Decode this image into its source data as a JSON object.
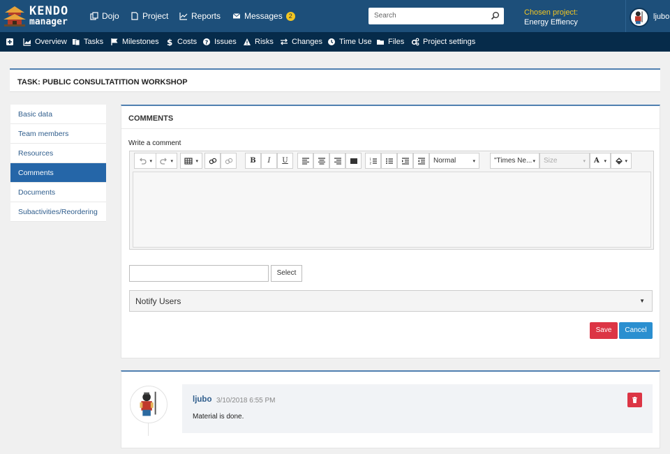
{
  "brand": {
    "line1": "KENDO",
    "line2": "manager"
  },
  "topnav": [
    {
      "label": "Dojo",
      "icon": "clone-icon"
    },
    {
      "label": "Project",
      "icon": "file-icon"
    },
    {
      "label": "Reports",
      "icon": "line-chart-icon"
    },
    {
      "label": "Messages",
      "icon": "envelope-icon",
      "badge": "2"
    }
  ],
  "search": {
    "placeholder": "Search"
  },
  "chosen_project": {
    "label": "Chosen project:",
    "value": "Energy Effiency"
  },
  "user": {
    "name": "ljubo"
  },
  "subnav": [
    {
      "label": "Overview",
      "icon": "area-chart-icon"
    },
    {
      "label": "Tasks",
      "icon": "files-icon"
    },
    {
      "label": "Milestones",
      "icon": "flag-icon"
    },
    {
      "label": "Costs",
      "icon": "dollar-icon"
    },
    {
      "label": "Issues",
      "icon": "question-circle-icon"
    },
    {
      "label": "Risks",
      "icon": "warning-icon"
    },
    {
      "label": "Changes",
      "icon": "exchange-icon"
    },
    {
      "label": "Time Use",
      "icon": "clock-icon"
    },
    {
      "label": "Files",
      "icon": "folder-icon"
    },
    {
      "label": "Project settings",
      "icon": "cogs-icon"
    }
  ],
  "task": {
    "title": "TASK: PUBLIC CONSULTATITION WORKSHOP"
  },
  "sidebar": {
    "items": [
      {
        "label": "Basic data"
      },
      {
        "label": "Team members"
      },
      {
        "label": "Resources"
      },
      {
        "label": "Comments",
        "active": true
      },
      {
        "label": "Documents"
      },
      {
        "label": "Subactivities/Reordering"
      }
    ]
  },
  "comments": {
    "title": "COMMENTS",
    "write_label": "Write a comment",
    "editor": {
      "format": "Normal",
      "font": "\"Times Ne...",
      "size_placeholder": "Size"
    },
    "select_label": "Select",
    "notify_label": "Notify Users",
    "save_label": "Save",
    "cancel_label": "Cancel"
  },
  "comment_list": [
    {
      "author": "ljubo",
      "date": "3/10/2018 6:55 PM",
      "text": "Material is done."
    }
  ],
  "colors": {
    "topbar": "#1d4f7a",
    "subnav": "#062b4a",
    "accent": "#2566a8",
    "danger": "#dc3545",
    "primary": "#2b8fd0",
    "highlight": "#f3c623"
  }
}
